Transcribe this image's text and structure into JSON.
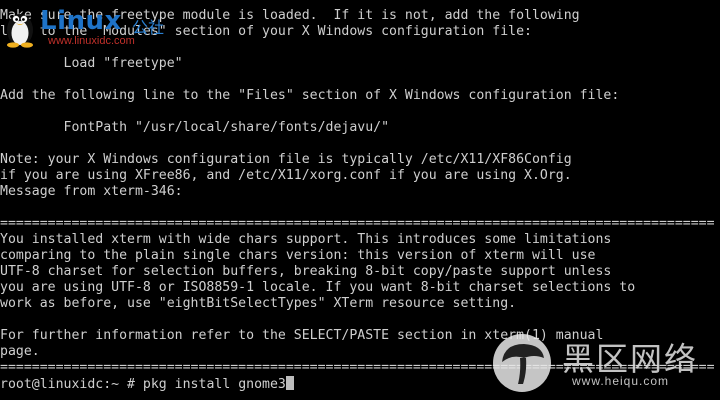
{
  "terminal": {
    "lines": [
      "Make sure the freetype module is loaded.  If it is not, add the following",
      "line to the \"Modules\" section of your X Windows configuration file:",
      "",
      "        Load \"freetype\"",
      "",
      "Add the following line to the \"Files\" section of X Windows configuration file:",
      "",
      "        FontPath \"/usr/local/share/fonts/dejavu/\"",
      "",
      "Note: your X Windows configuration file is typically /etc/X11/XF86Config",
      "if you are using XFree86, and /etc/X11/xorg.conf if you are using X.Org.",
      "Message from xterm-346:",
      "",
      "==========================================================================================",
      "You installed xterm with wide chars support. This introduces some limitations",
      "comparing to the plain single chars version: this version of xterm will use",
      "UTF-8 charset for selection buffers, breaking 8-bit copy/paste support unless",
      "you are using UTF-8 or ISO8859-1 locale. If you want 8-bit charset selections to",
      "work as before, use \"eightBitSelectTypes\" XTerm resource setting.",
      "",
      "For further information refer to the SELECT/PASTE section in xterm(1) manual",
      "page.",
      "=========================================================================================="
    ],
    "prompt": "root@linuxidc:~ # ",
    "command": "pkg install gnome3"
  },
  "watermarks": {
    "linux_brand": "Linux",
    "linux_brand_cn": "公社",
    "linux_url": "www.linuxidc.com",
    "heiqu_title": "黑区网络",
    "heiqu_site": "www.heiqu.com"
  },
  "colors": {
    "background": "#000000",
    "foreground": "#cfcfcf",
    "linux_blue": "#1e73c8",
    "linux_red": "#c0302a"
  }
}
